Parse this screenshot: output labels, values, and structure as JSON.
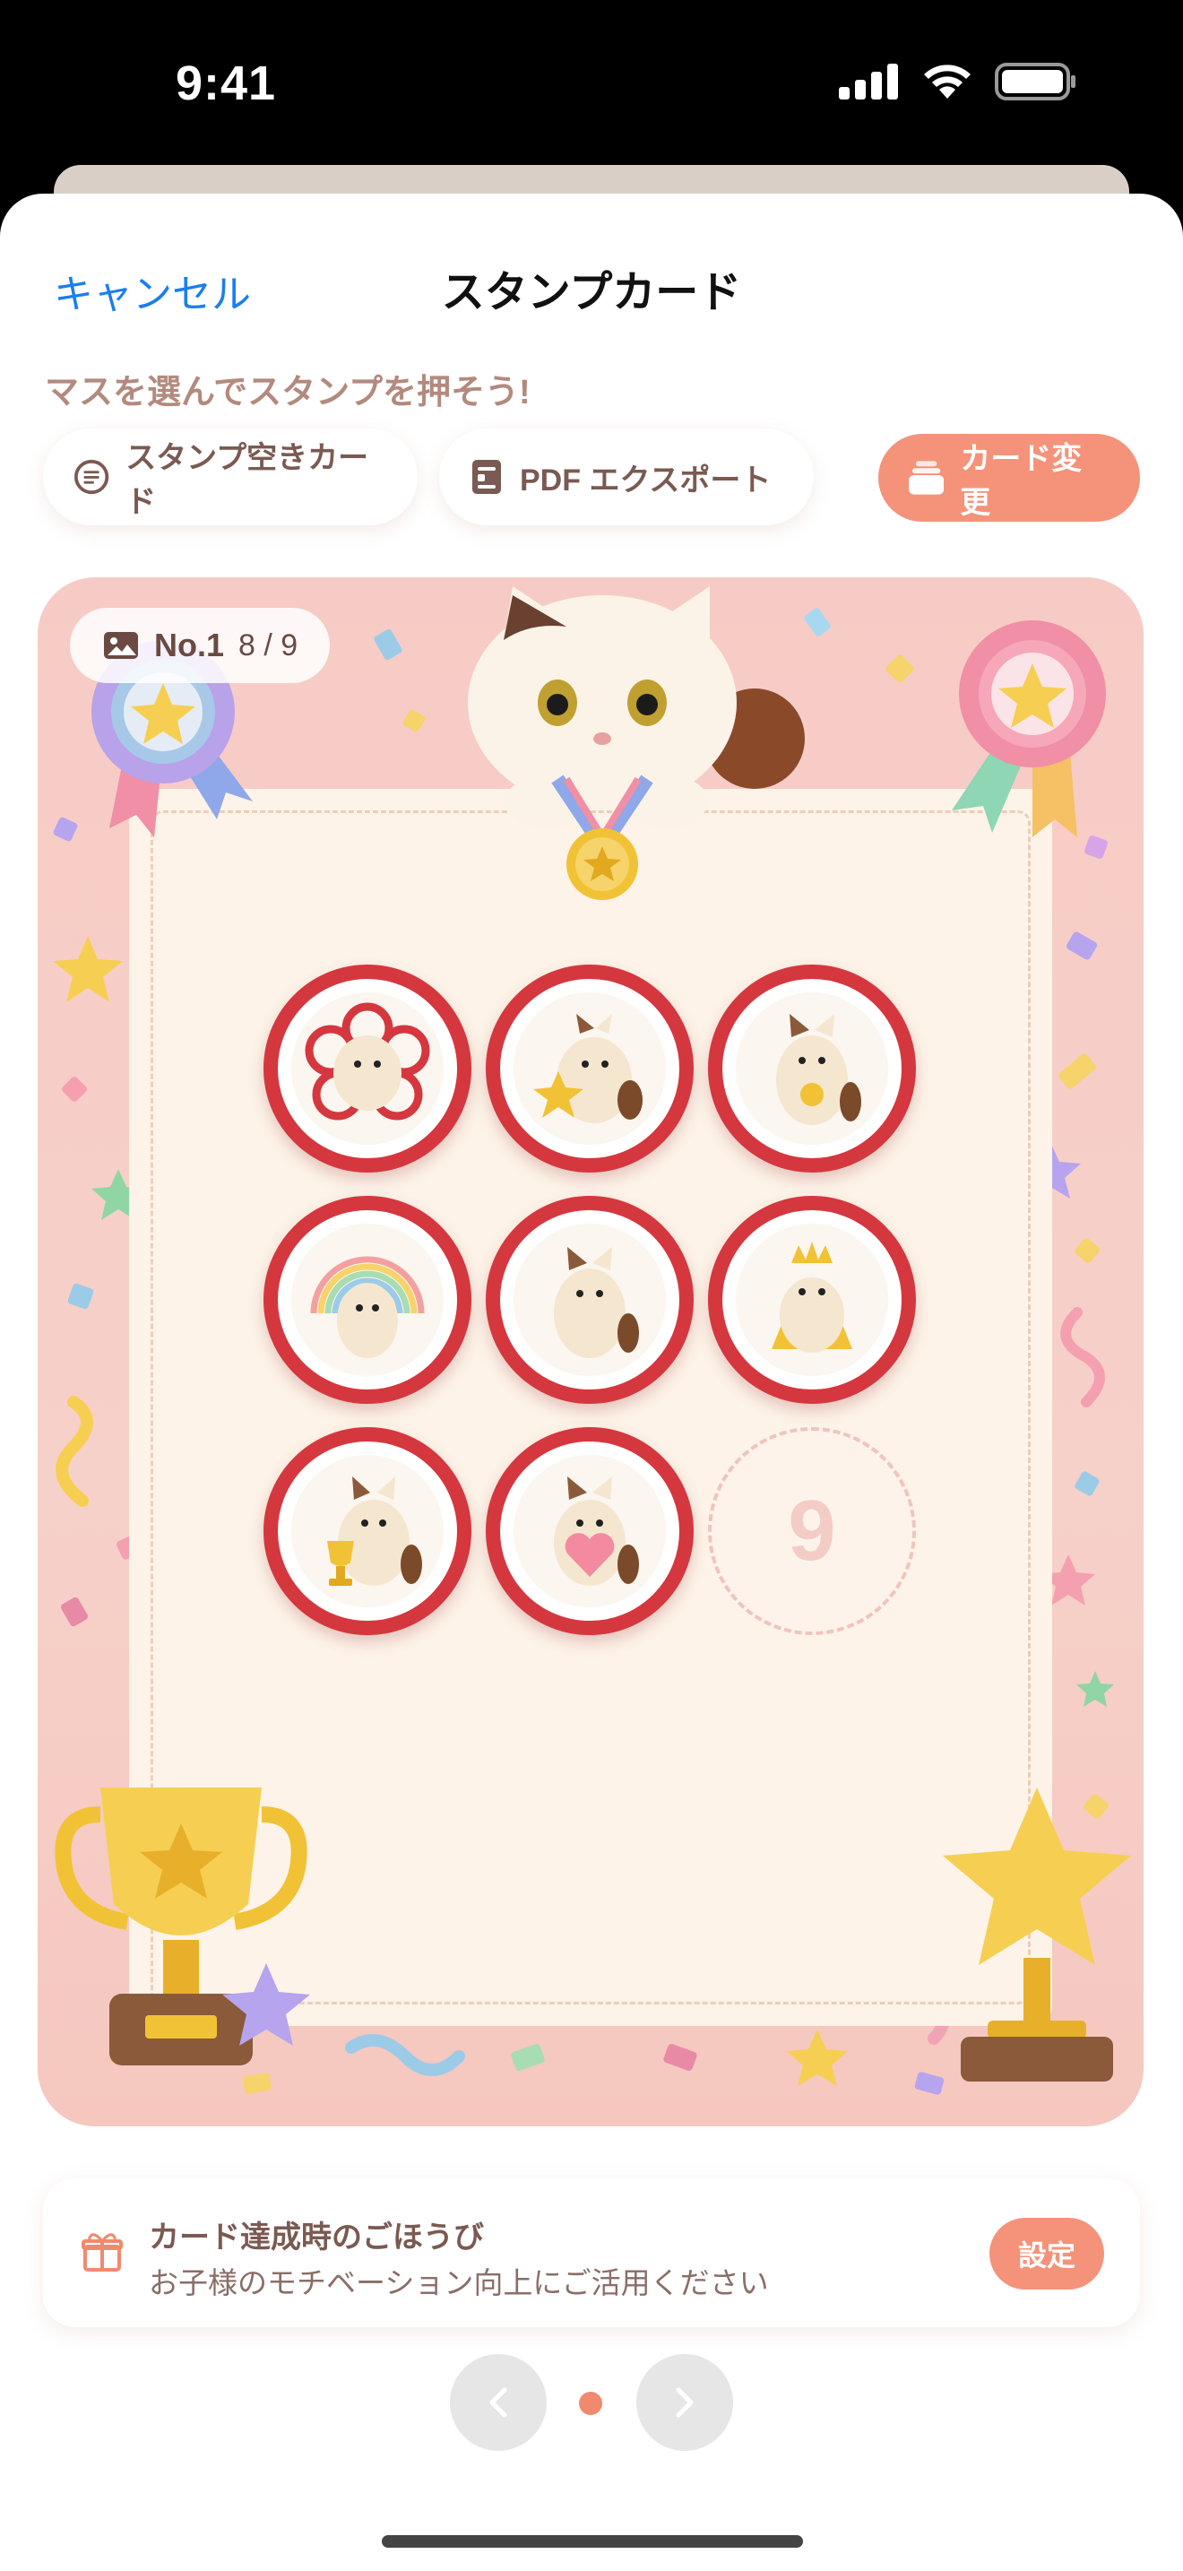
{
  "status": {
    "time": "9:41"
  },
  "nav": {
    "cancel": "キャンセル",
    "title": "スタンプカード"
  },
  "hint": "マスを選んでスタンプを押そう!",
  "toolbar": {
    "blank_card": "スタンプ空きカード",
    "pdf_export": "PDF エクスポート",
    "change_card": "カード変更"
  },
  "card": {
    "number": "No.1",
    "progress": "8 / 9",
    "stamped": 8,
    "total": 9,
    "empty_label": "9",
    "colors": {
      "stamp_ring": "#d5373f",
      "card_bg": "#f7cbc5",
      "accent": "#f4937a"
    }
  },
  "reward": {
    "title": "カード達成時のごほうび",
    "subtitle": "お子様のモチベーション向上にご活用ください",
    "button": "設定"
  },
  "pager": {
    "current_page": 1,
    "page_count": 1
  }
}
